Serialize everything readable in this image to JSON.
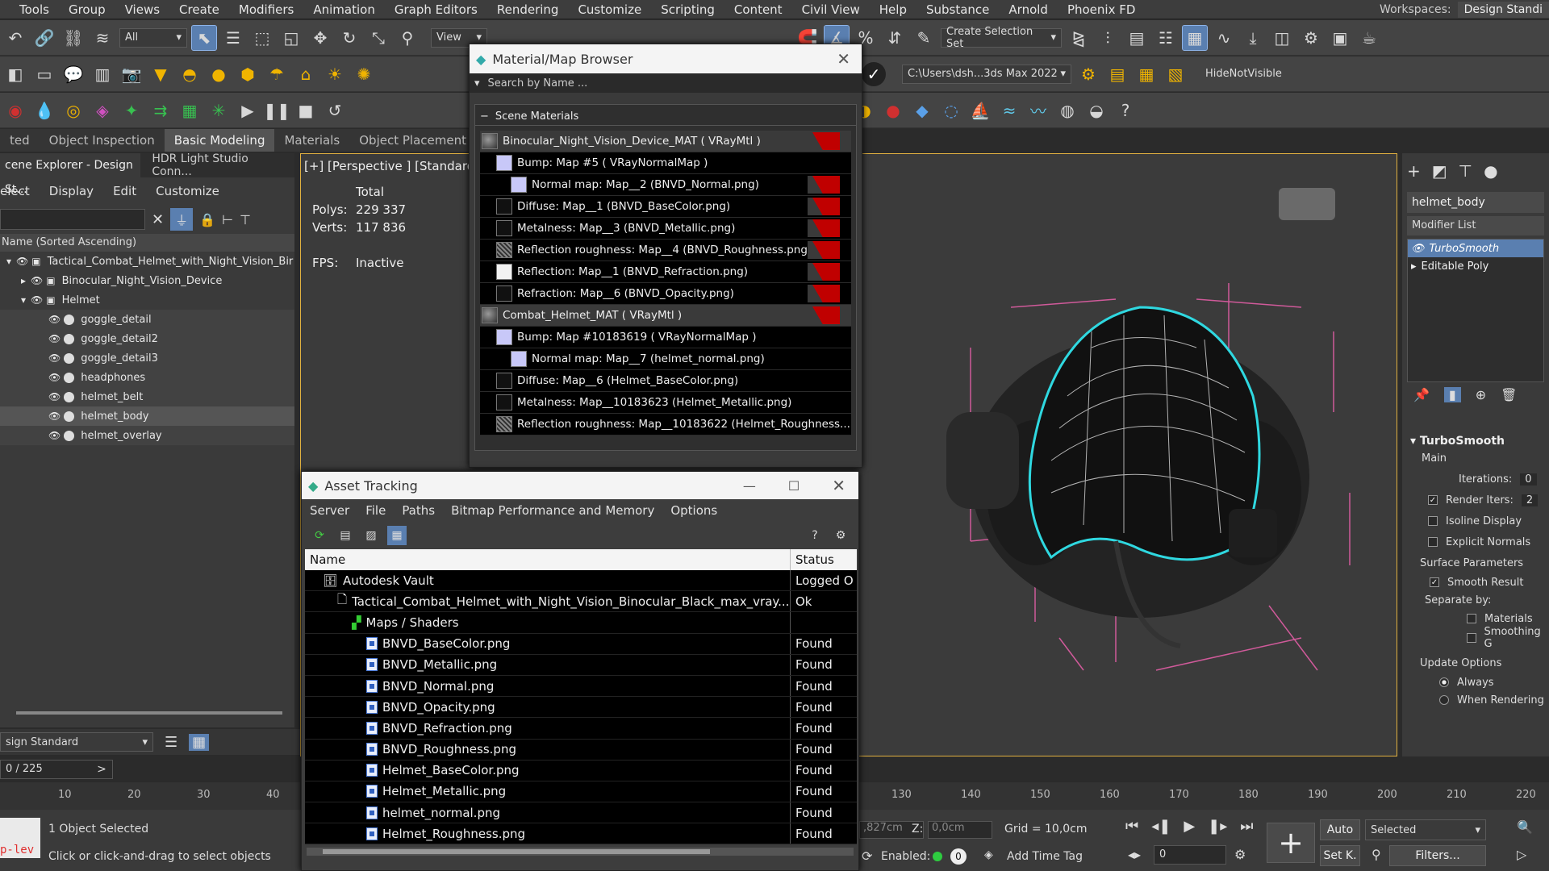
{
  "menubar": {
    "items": [
      "Tools",
      "Group",
      "Views",
      "Create",
      "Modifiers",
      "Animation",
      "Graph Editors",
      "Rendering",
      "Customize",
      "Scripting",
      "Content",
      "Civil View",
      "Help",
      "Substance",
      "Arnold",
      "Phoenix FD"
    ],
    "workspaces_label": "Workspaces:",
    "workspaces_value": "Design Standi"
  },
  "toolbar": {
    "filter_value": "All",
    "view_value": "View",
    "selection_set": "Create Selection Set",
    "path_value": "C:\\Users\\dsh...3ds Max 2022",
    "hide_label": "HideNotVisible"
  },
  "ribbon": {
    "tabs": [
      "ted",
      "Object Inspection",
      "Basic Modeling",
      "Materials",
      "Object Placement"
    ],
    "active": "Basic Modeling"
  },
  "scene_explorer": {
    "tab1": "cene Explorer - Design St...",
    "tab2": "HDR Light Studio Conn...",
    "menu": [
      "elect",
      "Display",
      "Edit",
      "Customize"
    ],
    "column_header": "Name (Sorted Ascending)",
    "rows": [
      {
        "label": "Tactical_Combat_Helmet_with_Night_Vision_Bir"
      },
      {
        "label": "Binocular_Night_Vision_Device"
      },
      {
        "label": "Helmet"
      },
      {
        "label": "goggle_detail"
      },
      {
        "label": "goggle_detail2"
      },
      {
        "label": "goggle_detail3"
      },
      {
        "label": "headphones"
      },
      {
        "label": "helmet_belt"
      },
      {
        "label": "helmet_body"
      },
      {
        "label": "helmet_overlay"
      }
    ],
    "layer_dropdown": "sign Standard",
    "frame_counter": "0 / 225"
  },
  "viewport": {
    "label": "[+] [Perspective ] [Standard ]",
    "stats_total": "Total",
    "polys_label": "Polys:",
    "polys_value": "229 337",
    "verts_label": "Verts:",
    "verts_value": "117 836",
    "fps_label": "FPS:",
    "fps_value": "Inactive"
  },
  "material_browser": {
    "title": "Material/Map Browser",
    "search_placeholder": "Search by Name ...",
    "section": "Scene Materials",
    "rows": [
      {
        "label": "Binocular_Night_Vision_Device_MAT  ( VRayMtl )",
        "swatch": "ball",
        "indent": 0,
        "red": true
      },
      {
        "label": "Bump: Map #5  ( VRayNormalMap )",
        "swatch": "purple",
        "indent": 1,
        "red": false
      },
      {
        "label": "Normal map: Map__2 (BNVD_Normal.png)",
        "swatch": "purple",
        "indent": 2,
        "red": true
      },
      {
        "label": "Diffuse: Map__1 (BNVD_BaseColor.png)",
        "swatch": "dark",
        "indent": 1,
        "red": true
      },
      {
        "label": "Metalness: Map__3 (BNVD_Metallic.png)",
        "swatch": "dark",
        "indent": 1,
        "red": true
      },
      {
        "label": "Reflection roughness: Map__4 (BNVD_Roughness.png)",
        "swatch": "noise",
        "indent": 1,
        "red": true
      },
      {
        "label": "Reflection: Map__1 (BNVD_Refraction.png)",
        "swatch": "white",
        "indent": 1,
        "red": true
      },
      {
        "label": "Refraction: Map__6 (BNVD_Opacity.png)",
        "swatch": "dark",
        "indent": 1,
        "red": true
      },
      {
        "label": "Combat_Helmet_MAT  ( VRayMtl )",
        "swatch": "ball",
        "indent": 0,
        "red": true
      },
      {
        "label": "Bump: Map #10183619  ( VRayNormalMap )",
        "swatch": "purple",
        "indent": 1,
        "red": false
      },
      {
        "label": "Normal map: Map__7 (helmet_normal.png)",
        "swatch": "purple",
        "indent": 2,
        "red": false
      },
      {
        "label": "Diffuse: Map__6 (Helmet_BaseColor.png)",
        "swatch": "dark",
        "indent": 1,
        "red": false
      },
      {
        "label": "Metalness: Map__10183623 (Helmet_Metallic.png)",
        "swatch": "dark",
        "indent": 1,
        "red": false
      },
      {
        "label": "Reflection  roughness:  Map__10183622  (Helmet_Roughness...",
        "swatch": "noise",
        "indent": 1,
        "red": false
      }
    ]
  },
  "asset_tracking": {
    "title": "Asset Tracking",
    "menu": [
      "Server",
      "File",
      "Paths",
      "Bitmap Performance and Memory",
      "Options"
    ],
    "col_name": "Name",
    "col_status": "Status",
    "rows": [
      {
        "name": "Autodesk Vault",
        "status": "Logged O",
        "type": "vault"
      },
      {
        "name": "Tactical_Combat_Helmet_with_Night_Vision_Binocular_Black_max_vray....",
        "status": "Ok",
        "type": "file"
      },
      {
        "name": "Maps / Shaders",
        "status": "",
        "type": "folder"
      },
      {
        "name": "BNVD_BaseColor.png",
        "status": "Found",
        "type": "img"
      },
      {
        "name": "BNVD_Metallic.png",
        "status": "Found",
        "type": "img"
      },
      {
        "name": "BNVD_Normal.png",
        "status": "Found",
        "type": "img"
      },
      {
        "name": "BNVD_Opacity.png",
        "status": "Found",
        "type": "img"
      },
      {
        "name": "BNVD_Refraction.png",
        "status": "Found",
        "type": "img"
      },
      {
        "name": "BNVD_Roughness.png",
        "status": "Found",
        "type": "img"
      },
      {
        "name": "Helmet_BaseColor.png",
        "status": "Found",
        "type": "img"
      },
      {
        "name": "Helmet_Metallic.png",
        "status": "Found",
        "type": "img"
      },
      {
        "name": "helmet_normal.png",
        "status": "Found",
        "type": "img"
      },
      {
        "name": "Helmet_Roughness.png",
        "status": "Found",
        "type": "img"
      }
    ]
  },
  "command_panel": {
    "object_name": "helmet_body",
    "modifier_list": "Modifier List",
    "stack": [
      "TurboSmooth",
      "Editable Poly"
    ],
    "rollout_title": "TurboSmooth",
    "main_label": "Main",
    "iterations_label": "Iterations:",
    "iterations_value": "0",
    "render_iters_label": "Render Iters:",
    "render_iters_value": "2",
    "isoline": "Isoline Display",
    "explicit": "Explicit Normals",
    "surface_params": "Surface Parameters",
    "smooth_result": "Smooth Result",
    "separate_by": "Separate by:",
    "materials": "Materials",
    "smoothing": "Smoothing G",
    "update_options": "Update Options",
    "always": "Always",
    "when_rendering": "When Rendering"
  },
  "timeline": {
    "ticks_left": [
      "10",
      "20",
      "30",
      "40"
    ],
    "ticks_right": [
      "130",
      "140",
      "150",
      "160",
      "170",
      "180",
      "190",
      "200",
      "210",
      "220"
    ]
  },
  "status": {
    "script_label": "p-lev",
    "selected": "1 Object Selected",
    "prompt": "Click or click-and-drag to select objects",
    "x_value": ",827cm",
    "z_label": "Z:",
    "z_value": "0,0cm",
    "grid": "Grid = 10,0cm",
    "enabled": "Enabled:",
    "add_time_tag": "Add Time Tag",
    "auto": "Auto",
    "selected_dd": "Selected",
    "setk": "Set K.",
    "filters": "Filters...",
    "frame_value": "0"
  }
}
